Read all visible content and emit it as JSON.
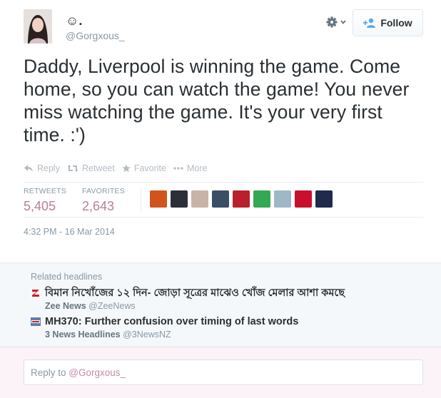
{
  "tweet": {
    "author_name": "☺.",
    "author_handle": "@Gorgxous_",
    "follow_label": "Follow",
    "text": "Daddy, Liverpool is winning the game. Come home, so you can watch the game! You never miss watching the game. It's your very first time. :')",
    "actions": {
      "reply": "Reply",
      "retweet": "Retweet",
      "favorite": "Favorite",
      "more": "More"
    },
    "stats": {
      "retweets_label": "RETWEETS",
      "retweets_value": "5,405",
      "favorites_label": "FAVORITES",
      "favorites_value": "2,643"
    },
    "favoriters": [
      {
        "color": "#d0551d"
      },
      {
        "color": "#2b2f3a"
      },
      {
        "color": "#c9b3a9"
      },
      {
        "color": "#3a4f66"
      },
      {
        "color": "#b7202c"
      },
      {
        "color": "#34a853"
      },
      {
        "color": "#9fb8c6"
      },
      {
        "color": "#c8102e"
      },
      {
        "color": "#1f2b4a"
      }
    ],
    "timestamp": "4:32 PM - 16 Mar 2014"
  },
  "related": {
    "title": "Related headlines",
    "items": [
      {
        "headline": "বিমান নিখোঁজের ১২ দিন- জোড়া সূত্রের মাঝেও খোঁজ মেলার আশা কমছে",
        "source_name": "Zee News",
        "source_handle": "@ZeeNews",
        "icon_color": "#d71920"
      },
      {
        "headline": "MH370: Further confusion over timing of last words",
        "source_name": "3 News Headlines",
        "source_handle": "@3NewsNZ",
        "icon_color": "#5b7fb3"
      }
    ]
  },
  "reply": {
    "prefix": "Reply to ",
    "mention": "@Gorgxous_"
  },
  "colors": {
    "accent_pink": "#b97d9c",
    "muted": "#8899a6",
    "action_gray": "#b4bcc3"
  },
  "icons": [
    "gear-icon",
    "add-user-icon",
    "reply-icon",
    "retweet-icon",
    "star-icon",
    "more-dots-icon"
  ]
}
